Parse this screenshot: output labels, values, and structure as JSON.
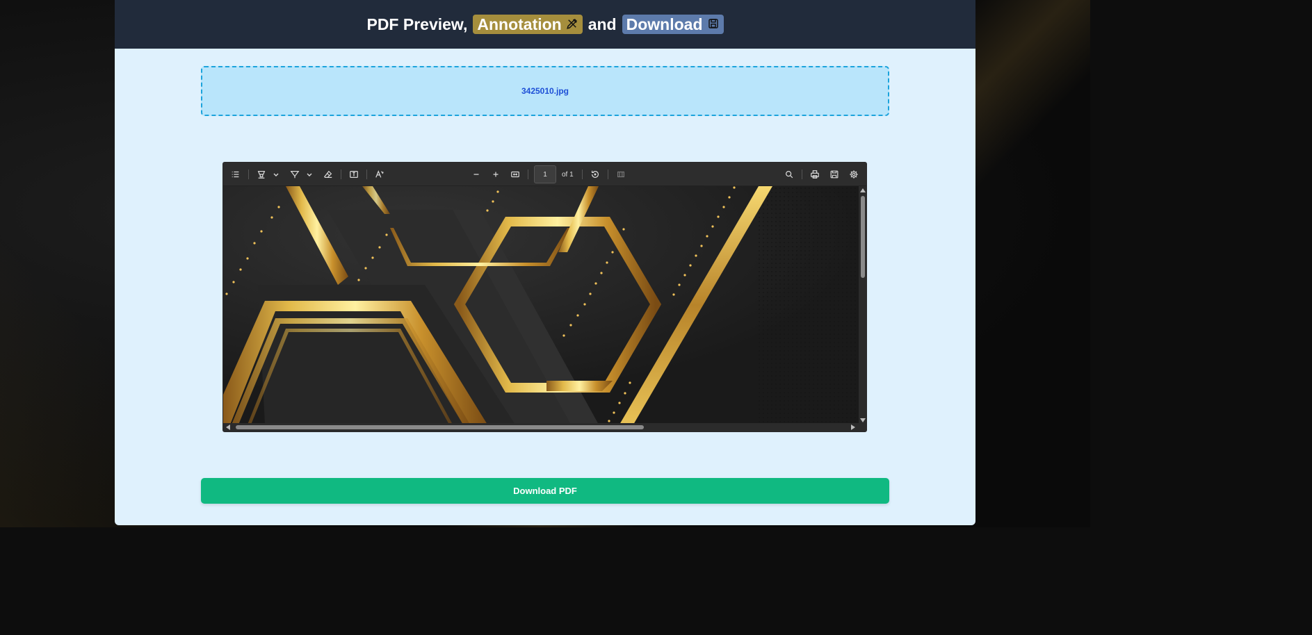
{
  "header": {
    "prefix": "PDF Preview,",
    "annotation_label": "Annotation",
    "and_label": "and",
    "download_label": "Download"
  },
  "dropzone": {
    "filename": "3425010.jpg"
  },
  "viewer": {
    "page_number": "1",
    "page_count_label": "of 1"
  },
  "download_button": {
    "label": "Download PDF"
  },
  "colors": {
    "header_bg": "#212b3b",
    "annotation_badge": "#a58e3d",
    "download_badge": "#5d7bab",
    "dropzone_bg": "#b9e5fb",
    "dropzone_border": "#1ba3dc",
    "download_button": "#10b981"
  },
  "icons": {
    "annotation": "pencil-ruler-icon",
    "download": "floppy-disk-icon"
  }
}
